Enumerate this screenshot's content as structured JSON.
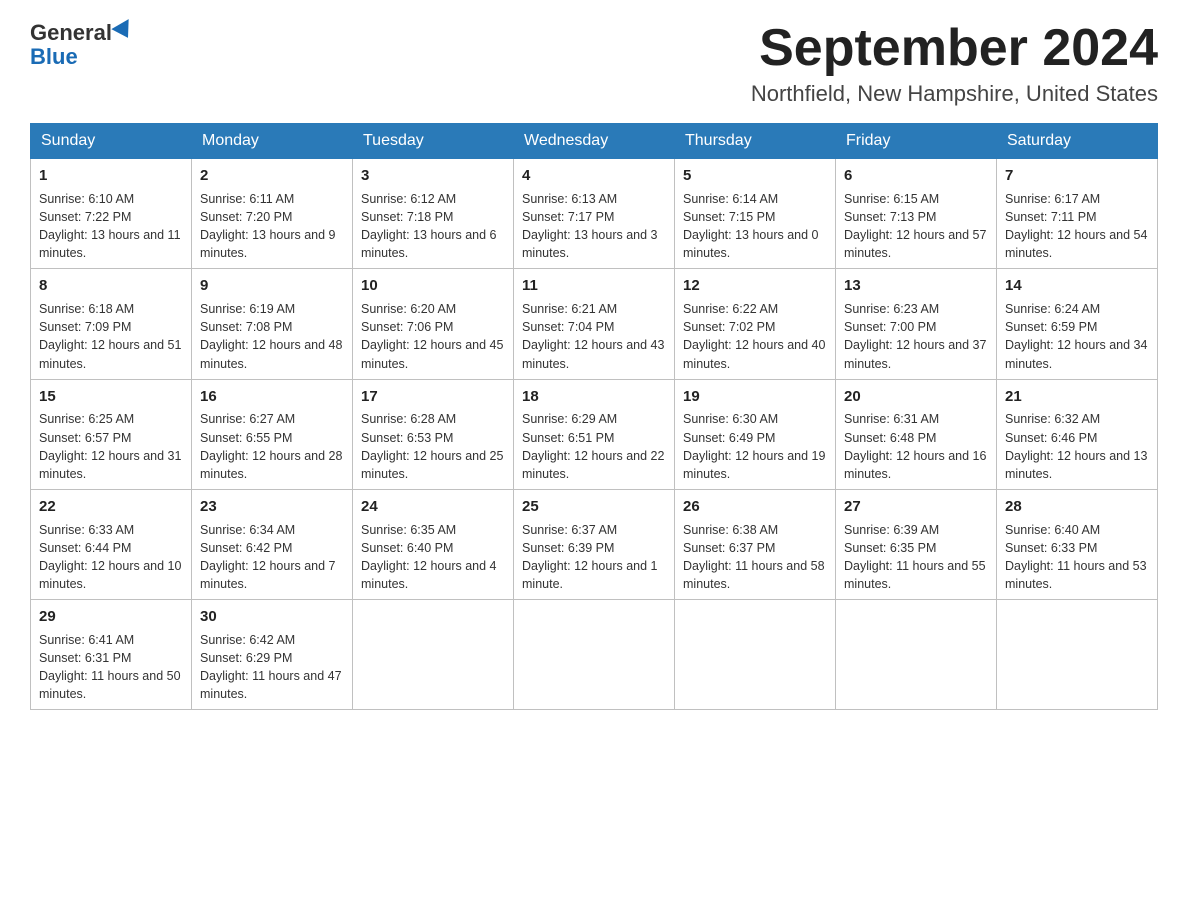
{
  "header": {
    "logo_general": "General",
    "logo_blue": "Blue",
    "month_title": "September 2024",
    "location": "Northfield, New Hampshire, United States"
  },
  "days_of_week": [
    "Sunday",
    "Monday",
    "Tuesday",
    "Wednesday",
    "Thursday",
    "Friday",
    "Saturday"
  ],
  "weeks": [
    [
      {
        "day": "1",
        "sunrise": "6:10 AM",
        "sunset": "7:22 PM",
        "daylight": "13 hours and 11 minutes."
      },
      {
        "day": "2",
        "sunrise": "6:11 AM",
        "sunset": "7:20 PM",
        "daylight": "13 hours and 9 minutes."
      },
      {
        "day": "3",
        "sunrise": "6:12 AM",
        "sunset": "7:18 PM",
        "daylight": "13 hours and 6 minutes."
      },
      {
        "day": "4",
        "sunrise": "6:13 AM",
        "sunset": "7:17 PM",
        "daylight": "13 hours and 3 minutes."
      },
      {
        "day": "5",
        "sunrise": "6:14 AM",
        "sunset": "7:15 PM",
        "daylight": "13 hours and 0 minutes."
      },
      {
        "day": "6",
        "sunrise": "6:15 AM",
        "sunset": "7:13 PM",
        "daylight": "12 hours and 57 minutes."
      },
      {
        "day": "7",
        "sunrise": "6:17 AM",
        "sunset": "7:11 PM",
        "daylight": "12 hours and 54 minutes."
      }
    ],
    [
      {
        "day": "8",
        "sunrise": "6:18 AM",
        "sunset": "7:09 PM",
        "daylight": "12 hours and 51 minutes."
      },
      {
        "day": "9",
        "sunrise": "6:19 AM",
        "sunset": "7:08 PM",
        "daylight": "12 hours and 48 minutes."
      },
      {
        "day": "10",
        "sunrise": "6:20 AM",
        "sunset": "7:06 PM",
        "daylight": "12 hours and 45 minutes."
      },
      {
        "day": "11",
        "sunrise": "6:21 AM",
        "sunset": "7:04 PM",
        "daylight": "12 hours and 43 minutes."
      },
      {
        "day": "12",
        "sunrise": "6:22 AM",
        "sunset": "7:02 PM",
        "daylight": "12 hours and 40 minutes."
      },
      {
        "day": "13",
        "sunrise": "6:23 AM",
        "sunset": "7:00 PM",
        "daylight": "12 hours and 37 minutes."
      },
      {
        "day": "14",
        "sunrise": "6:24 AM",
        "sunset": "6:59 PM",
        "daylight": "12 hours and 34 minutes."
      }
    ],
    [
      {
        "day": "15",
        "sunrise": "6:25 AM",
        "sunset": "6:57 PM",
        "daylight": "12 hours and 31 minutes."
      },
      {
        "day": "16",
        "sunrise": "6:27 AM",
        "sunset": "6:55 PM",
        "daylight": "12 hours and 28 minutes."
      },
      {
        "day": "17",
        "sunrise": "6:28 AM",
        "sunset": "6:53 PM",
        "daylight": "12 hours and 25 minutes."
      },
      {
        "day": "18",
        "sunrise": "6:29 AM",
        "sunset": "6:51 PM",
        "daylight": "12 hours and 22 minutes."
      },
      {
        "day": "19",
        "sunrise": "6:30 AM",
        "sunset": "6:49 PM",
        "daylight": "12 hours and 19 minutes."
      },
      {
        "day": "20",
        "sunrise": "6:31 AM",
        "sunset": "6:48 PM",
        "daylight": "12 hours and 16 minutes."
      },
      {
        "day": "21",
        "sunrise": "6:32 AM",
        "sunset": "6:46 PM",
        "daylight": "12 hours and 13 minutes."
      }
    ],
    [
      {
        "day": "22",
        "sunrise": "6:33 AM",
        "sunset": "6:44 PM",
        "daylight": "12 hours and 10 minutes."
      },
      {
        "day": "23",
        "sunrise": "6:34 AM",
        "sunset": "6:42 PM",
        "daylight": "12 hours and 7 minutes."
      },
      {
        "day": "24",
        "sunrise": "6:35 AM",
        "sunset": "6:40 PM",
        "daylight": "12 hours and 4 minutes."
      },
      {
        "day": "25",
        "sunrise": "6:37 AM",
        "sunset": "6:39 PM",
        "daylight": "12 hours and 1 minute."
      },
      {
        "day": "26",
        "sunrise": "6:38 AM",
        "sunset": "6:37 PM",
        "daylight": "11 hours and 58 minutes."
      },
      {
        "day": "27",
        "sunrise": "6:39 AM",
        "sunset": "6:35 PM",
        "daylight": "11 hours and 55 minutes."
      },
      {
        "day": "28",
        "sunrise": "6:40 AM",
        "sunset": "6:33 PM",
        "daylight": "11 hours and 53 minutes."
      }
    ],
    [
      {
        "day": "29",
        "sunrise": "6:41 AM",
        "sunset": "6:31 PM",
        "daylight": "11 hours and 50 minutes."
      },
      {
        "day": "30",
        "sunrise": "6:42 AM",
        "sunset": "6:29 PM",
        "daylight": "11 hours and 47 minutes."
      },
      null,
      null,
      null,
      null,
      null
    ]
  ]
}
